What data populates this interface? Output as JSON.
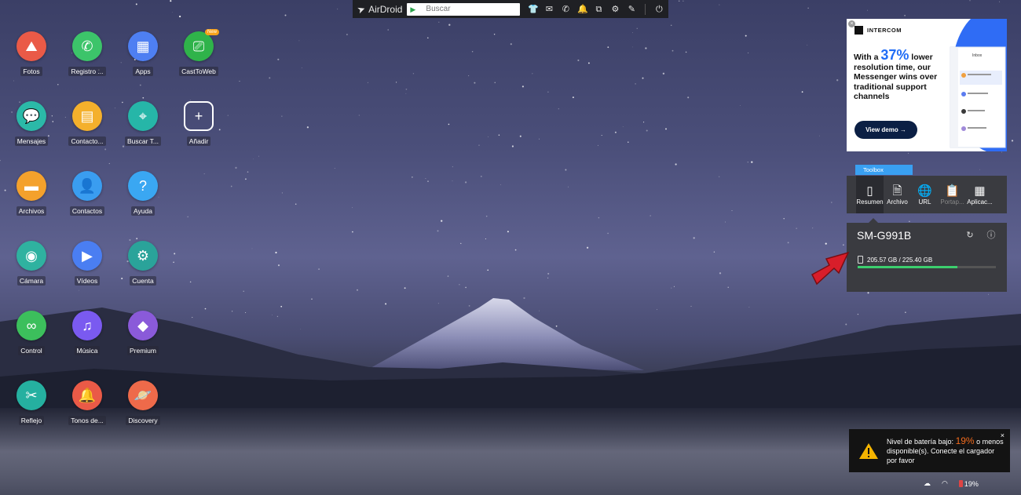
{
  "topbar": {
    "brand": "AirDroid",
    "search_placeholder": "Buscar",
    "icons": [
      "shirt-icon",
      "mail-icon",
      "phone-icon",
      "bell-icon",
      "copy-icon",
      "gear-icon",
      "pen-icon",
      "power-icon"
    ]
  },
  "apps": [
    {
      "label": "Fotos",
      "icon": "photos-icon",
      "color": "#ea5a47"
    },
    {
      "label": "Registro ...",
      "icon": "phone-icon",
      "color": "#3cc46a"
    },
    {
      "label": "Apps",
      "icon": "apps-grid-icon",
      "color": "#4e7ff2"
    },
    {
      "label": "CastToWeb",
      "icon": "cast-icon",
      "color": "#2fb34a",
      "badge": "New"
    },
    {
      "label": "Mensajes",
      "icon": "chat-icon",
      "color": "#2bb9a8"
    },
    {
      "label": "Contacto...",
      "icon": "contact-card-icon",
      "color": "#f4b02c"
    },
    {
      "label": "Buscar T...",
      "icon": "location-pin-icon",
      "color": "#26b6a8"
    },
    {
      "label": "Añadir",
      "icon": "plus-icon",
      "color": "transparent"
    },
    {
      "label": "Archivos",
      "icon": "folder-icon",
      "color": "#f4a12c"
    },
    {
      "label": "Contactos",
      "icon": "person-icon",
      "color": "#3a9df0"
    },
    {
      "label": "Ayuda",
      "icon": "question-icon",
      "color": "#3aa7f2"
    },
    {
      "label": "Cámara",
      "icon": "camera-icon",
      "color": "#2fb2a0"
    },
    {
      "label": "Vídeos",
      "icon": "play-icon",
      "color": "#4a7ef2"
    },
    {
      "label": "Cuenta",
      "icon": "gear-icon",
      "color": "#2aa39a"
    },
    {
      "label": "Control",
      "icon": "binoculars-icon",
      "color": "#3cbf5c"
    },
    {
      "label": "Música",
      "icon": "music-icon",
      "color": "#7a5af0"
    },
    {
      "label": "Premium",
      "icon": "diamond-icon",
      "color": "#8a5ad9"
    },
    {
      "label": "Reflejo",
      "icon": "scissors-icon",
      "color": "#25b0a0"
    },
    {
      "label": "Tonos de...",
      "icon": "bell-icon",
      "color": "#ea5a47"
    },
    {
      "label": "Discovery",
      "icon": "planet-icon",
      "color": "#ee6a4a"
    }
  ],
  "ad": {
    "brand": "INTERCOM",
    "line1": "With a",
    "pct": "37%",
    "line2": "lower resolution time, our Messenger wins over traditional support channels",
    "cta": "View demo →",
    "preview_title": "Inbox"
  },
  "toolbox": {
    "tab": "Toolbox",
    "tools": [
      {
        "label": "Resumen",
        "icon": "phone-outline-icon",
        "active": true
      },
      {
        "label": "Archivo",
        "icon": "document-icon"
      },
      {
        "label": "URL",
        "icon": "globe-icon"
      },
      {
        "label": "Portap...",
        "icon": "clipboard-icon",
        "dim": true
      },
      {
        "label": "Aplicac...",
        "icon": "app-box-icon"
      }
    ]
  },
  "device": {
    "name": "SM-G991B",
    "storage_text": "205.57 GB / 225.40 GB",
    "storage_fraction": 0.72
  },
  "notification": {
    "text_before": "Nivel de batería bajo:",
    "pct": "19%",
    "text_after": "o menos disponible(s). Conecte el cargador por favor",
    "close": "×"
  },
  "status": {
    "battery": "19%"
  },
  "colors": {
    "topbar": "#1f2024",
    "toolbox_tab": "#39a0f2",
    "panel": "#3a3b40",
    "storage_fill": "#3ccf6e",
    "warning": "#f5b400",
    "arrow": "#d81e2a"
  }
}
